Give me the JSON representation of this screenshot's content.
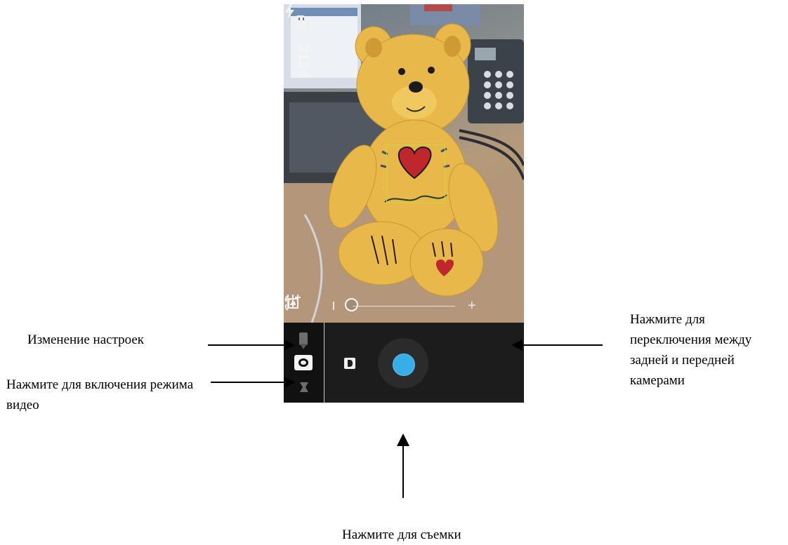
{
  "status": {
    "remaining_shots": "3134",
    "storage_icon": "sd-card-icon",
    "flash_icon": "flash-auto-icon"
  },
  "zoom": {
    "minus_label": "",
    "plus_label": "+",
    "level": 0.0
  },
  "controls": {
    "settings_icon": "sliders-icon",
    "switch_camera_icon": "switch-camera-icon",
    "modes": [
      "panorama-icon",
      "camera-icon",
      "video-icon"
    ],
    "selected_mode": "camera-icon",
    "thumbnail_icon": "gallery-thumbnail-icon",
    "shutter_color": "#38aee6"
  },
  "annotations": {
    "settings": "Изменение настроек",
    "video": "Нажмите для включения режима видео",
    "switch_camera": "Нажмите для переключения между задней и передней камерами",
    "shutter": "Нажмите для съемки"
  }
}
